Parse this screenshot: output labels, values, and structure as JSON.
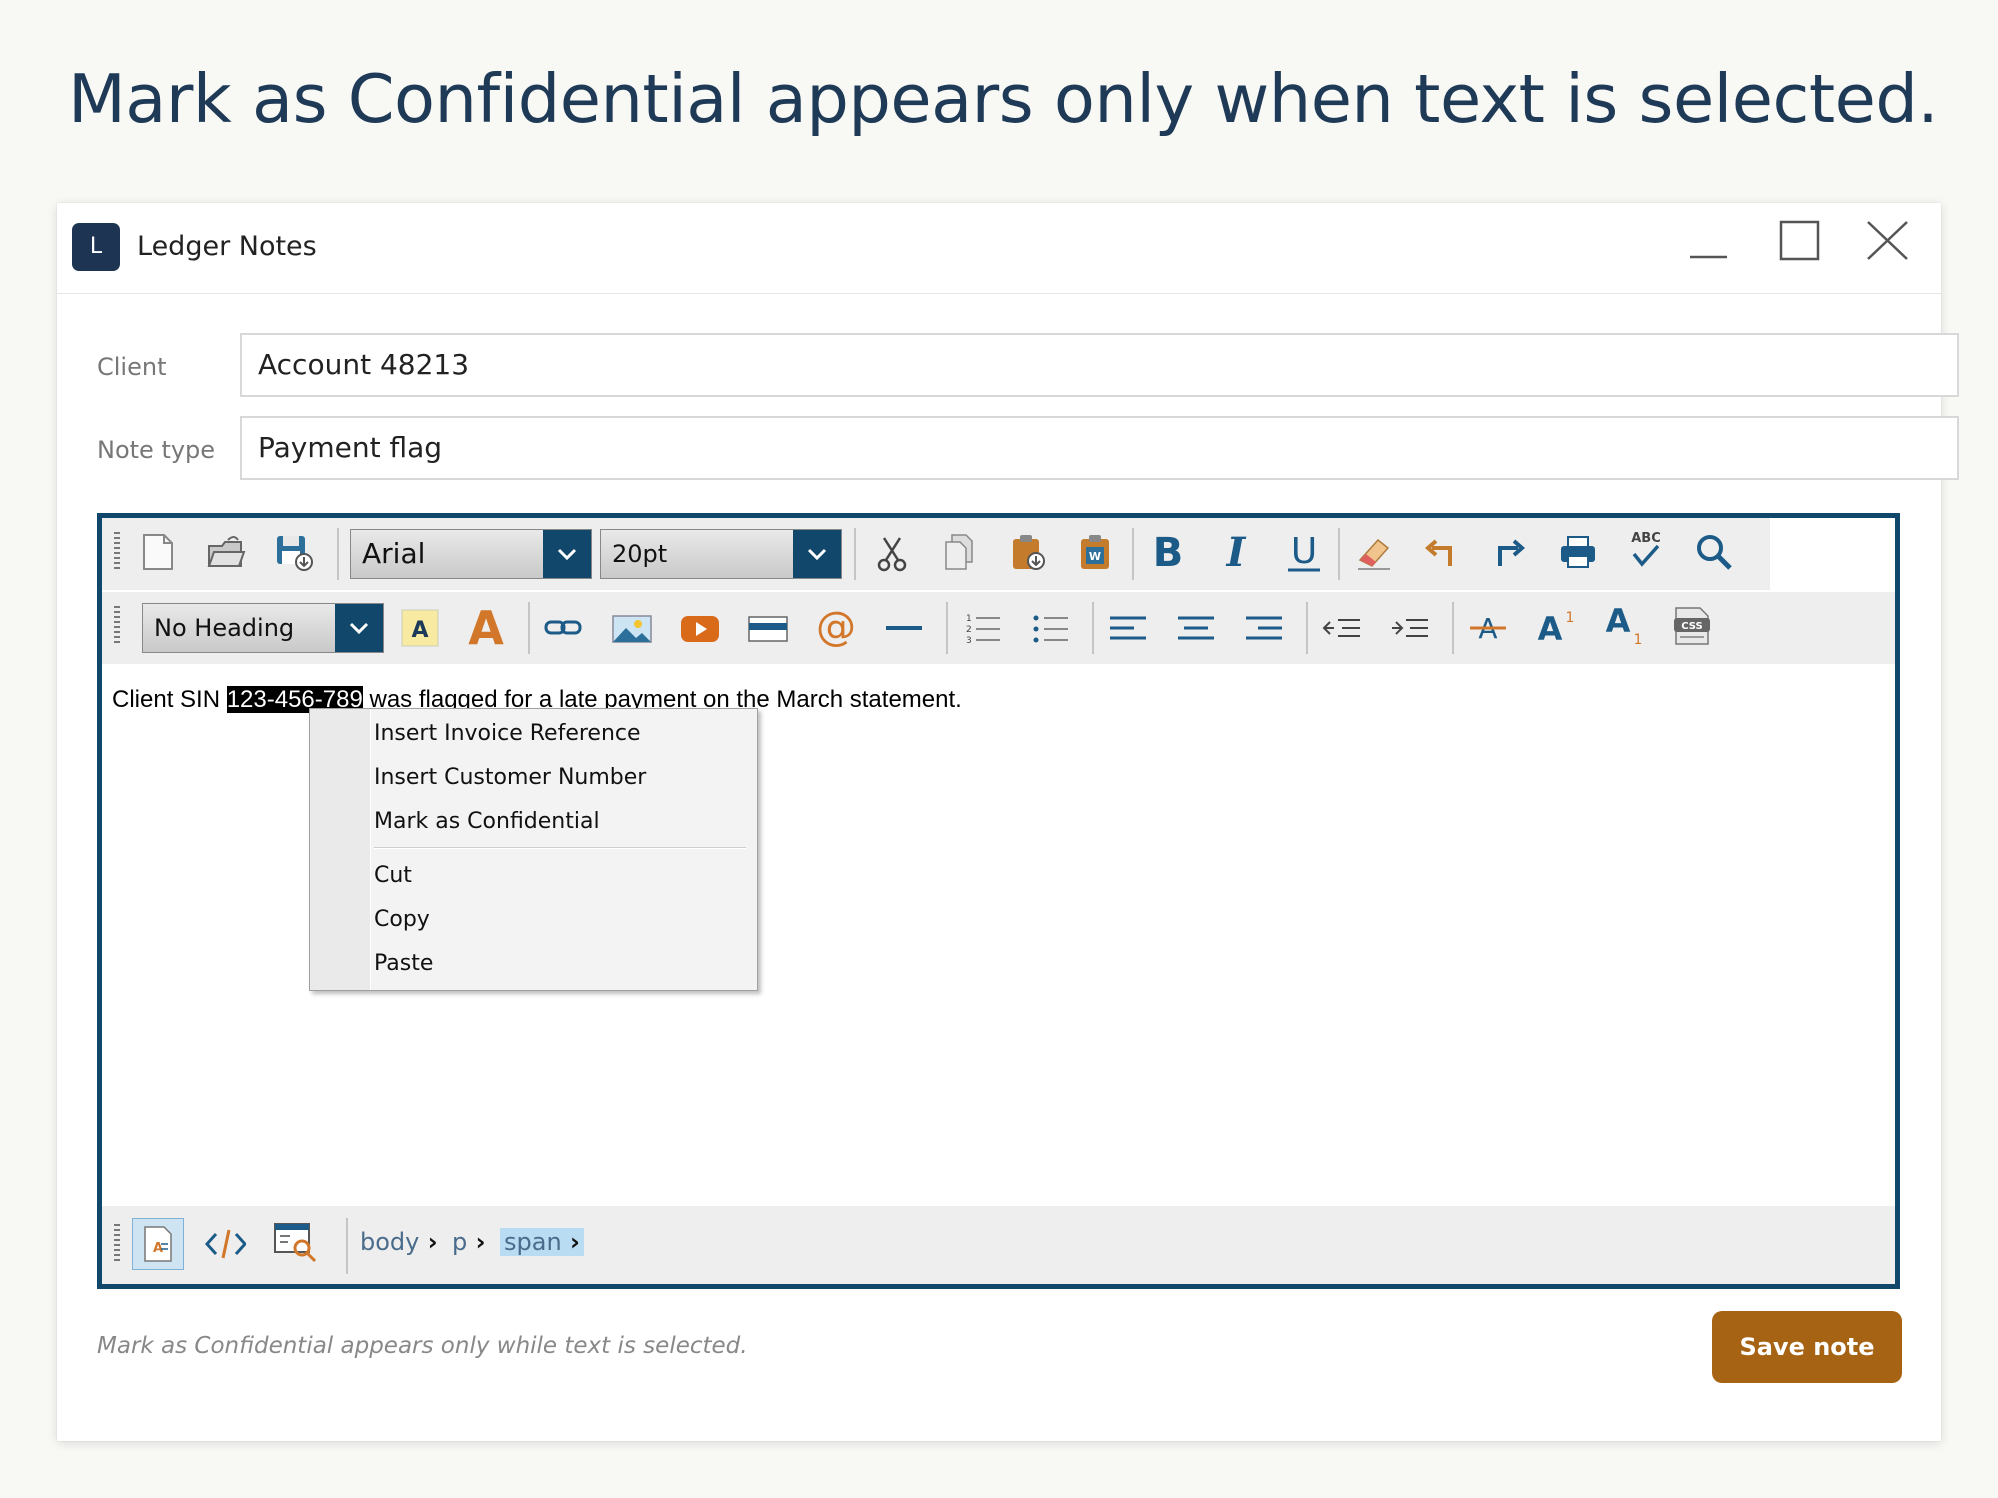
{
  "headline": "Mark as Confidential appears only when text is selected.",
  "window": {
    "logo_letter": "L",
    "title": "Ledger Notes",
    "controls": [
      "minimize-icon",
      "maximize-icon",
      "close-icon"
    ]
  },
  "form": {
    "client_label": "Client",
    "client_value": "Account 48213",
    "note_type_label": "Note type",
    "note_type_value": "Payment flag"
  },
  "toolbar": {
    "font_family": "Arial",
    "font_size": "20pt",
    "heading": "No Heading",
    "highlight_letter": "A",
    "font_color_letter": "A",
    "row1_icons": [
      "new-document-icon",
      "open-folder-icon",
      "save-icon",
      "cut-icon",
      "copy-icon",
      "paste-icon",
      "paste-from-word-icon",
      "bold-icon",
      "italic-icon",
      "underline-icon",
      "eraser-icon",
      "undo-icon",
      "redo-icon",
      "print-icon",
      "spellcheck-icon",
      "find-icon"
    ],
    "row2_icons": [
      "highlight-color-icon",
      "font-color-icon",
      "link-icon",
      "image-icon",
      "video-icon",
      "form-field-icon",
      "email-at-icon",
      "horizontal-rule-icon",
      "ordered-list-icon",
      "unordered-list-icon",
      "align-left-icon",
      "align-center-icon",
      "align-right-icon",
      "outdent-icon",
      "indent-icon",
      "strikethrough-icon",
      "superscript-icon",
      "subscript-icon",
      "css-icon"
    ],
    "spellcheck_text": "ABC",
    "css_text": "CSS"
  },
  "editor": {
    "text_before": "Client SIN ",
    "selected_text": "123-456-789",
    "text_after": " was flagged for a late payment on the March statement."
  },
  "context_menu": {
    "items": [
      "Insert Invoice Reference",
      "Insert Customer Number",
      "Mark as Confidential"
    ],
    "clipboard_items": [
      "Cut",
      "Copy",
      "Paste"
    ]
  },
  "bottom_bar": {
    "modes": [
      "design-view-icon",
      "source-code-icon",
      "preview-icon"
    ],
    "breadcrumbs": [
      "body",
      "p",
      "span"
    ],
    "active_crumb": "span"
  },
  "footer": {
    "hint": "Mark as Confidential appears only while text is selected.",
    "save_label": "Save note"
  },
  "colors": {
    "accent_navy": "#12476c",
    "save_button": "#a76314",
    "selection_bg": "#000000"
  }
}
